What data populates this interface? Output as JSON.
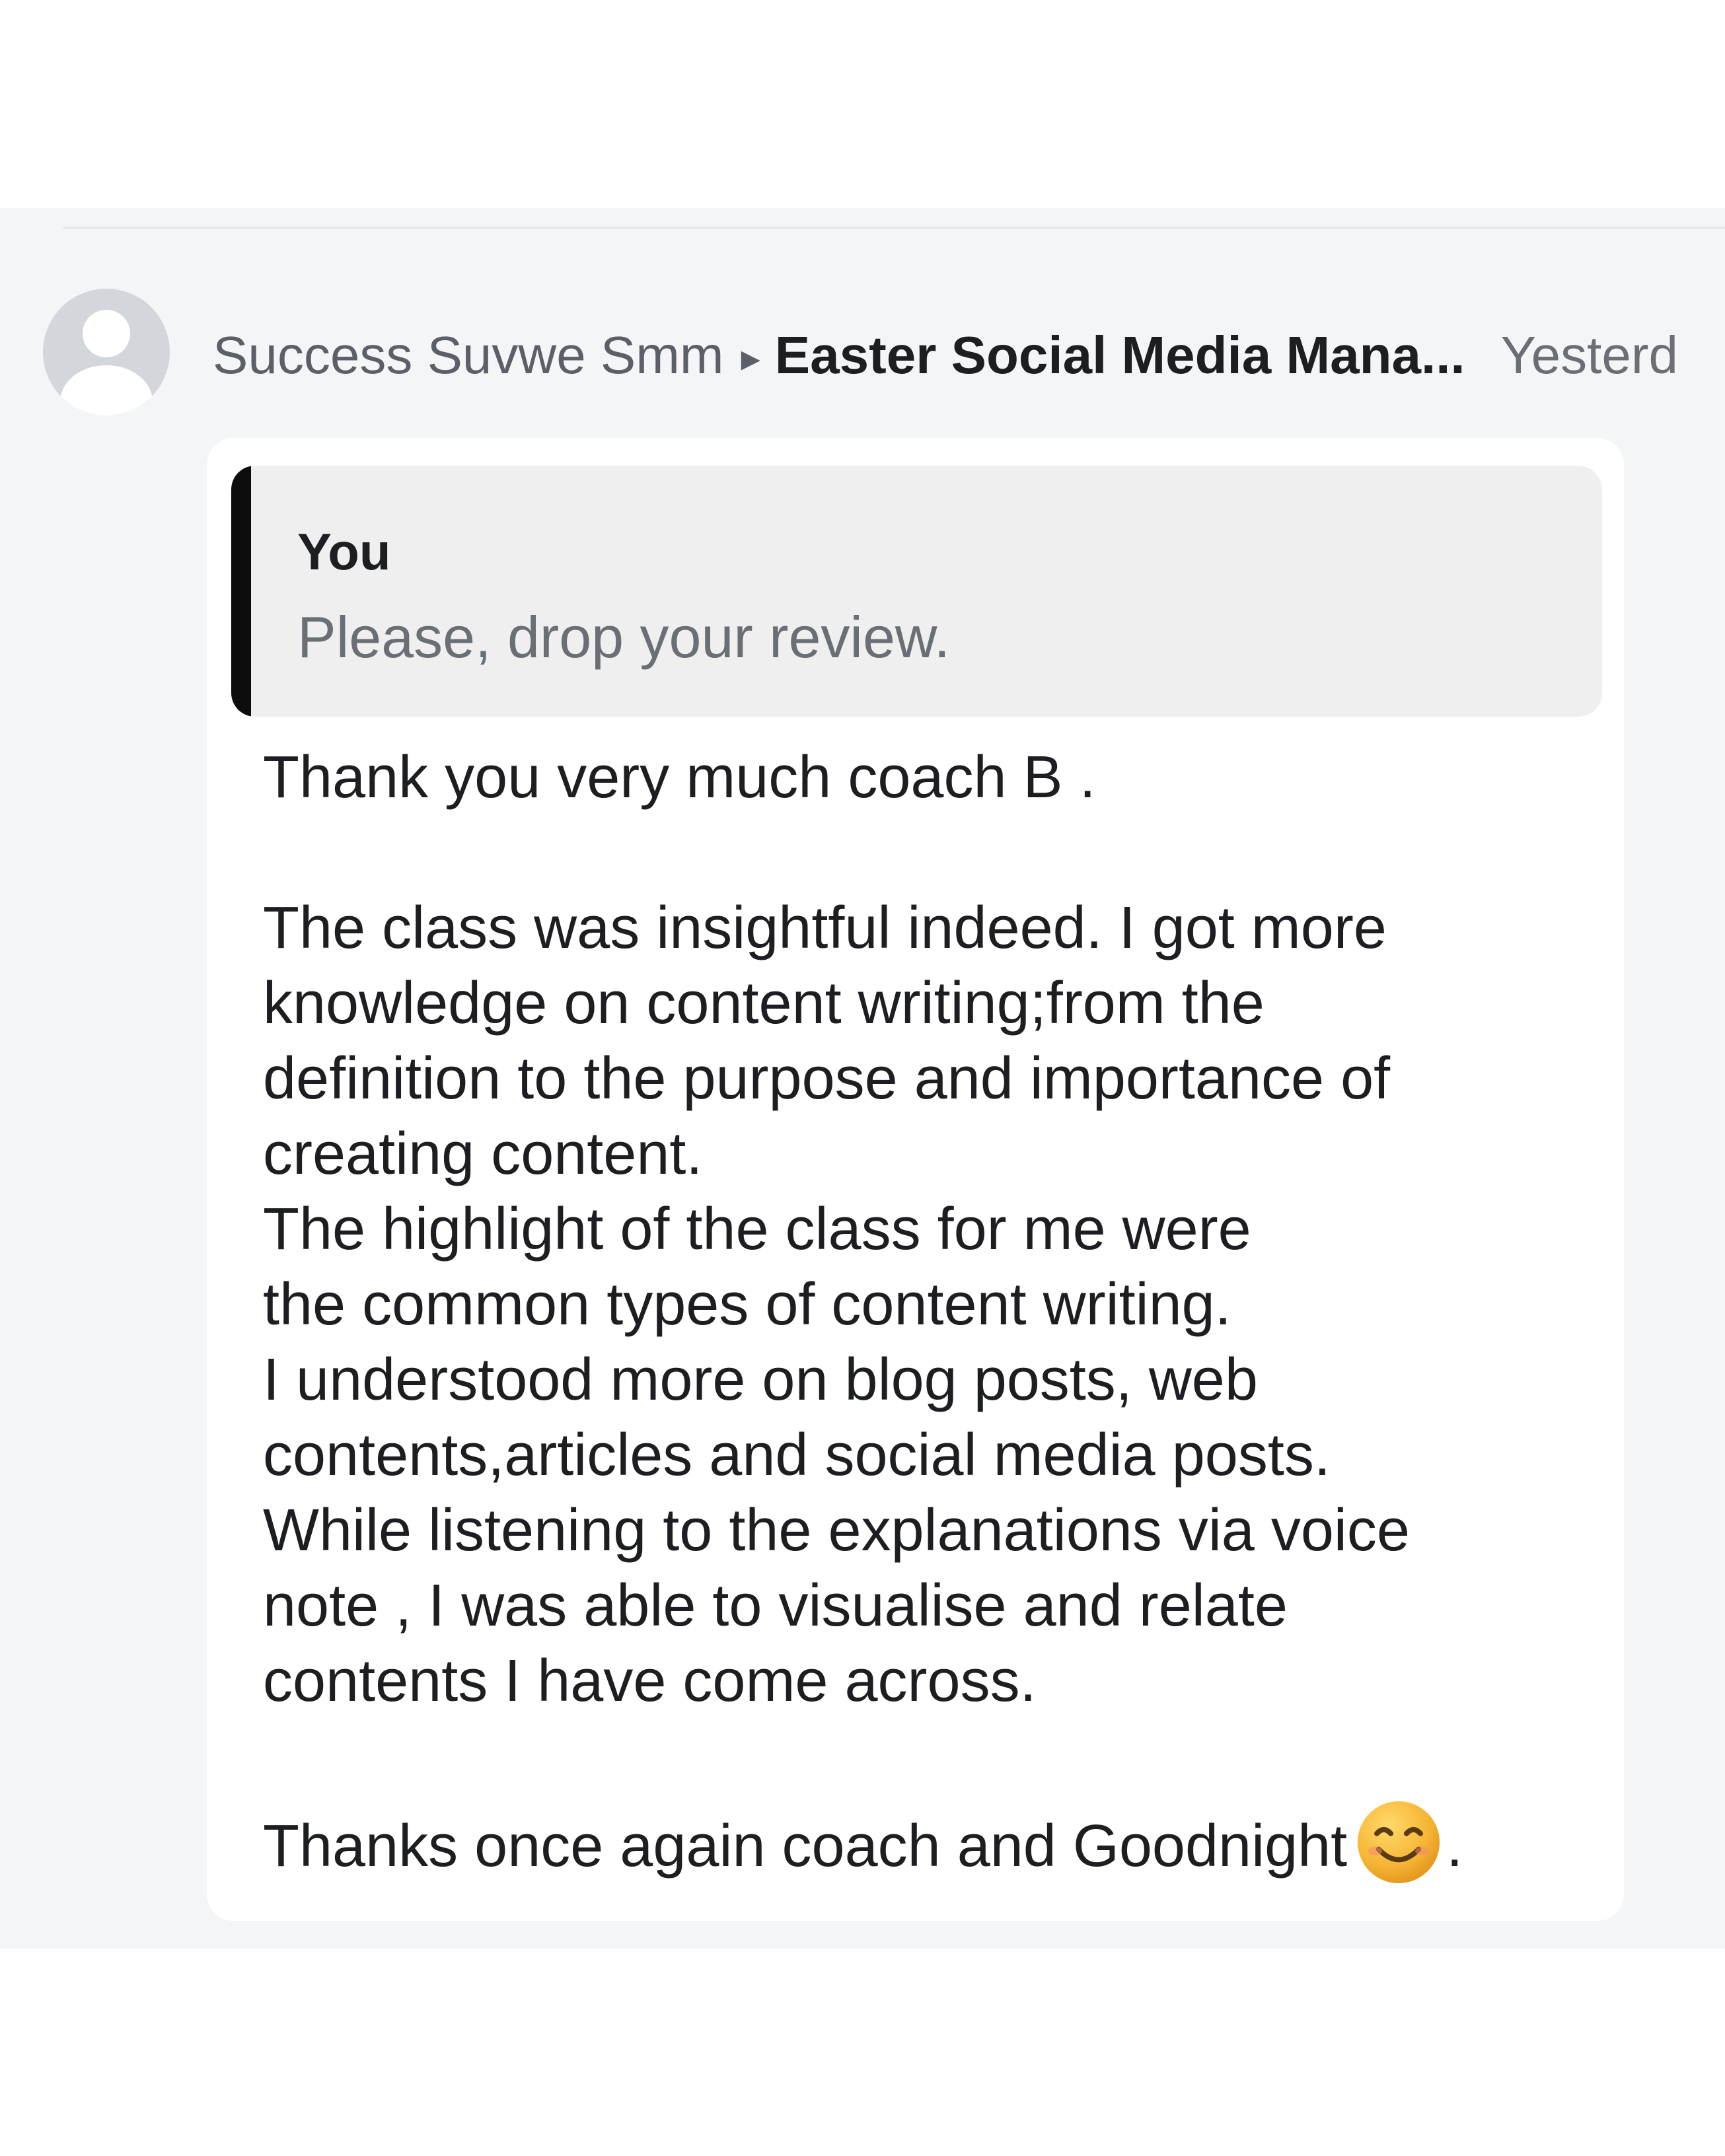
{
  "post_header": {
    "sender_name": "Success Suvwe Smm",
    "group_name": "Easter Social Media Mana...",
    "timestamp": "Yesterd"
  },
  "quoted_reply": {
    "author": "You",
    "text": "Please, drop your review."
  },
  "message": {
    "line_1": "Thank you very much coach B .",
    "line_2": "The class was insightful indeed. I got more",
    "line_3": "knowledge on content writing;from the",
    "line_4": "definition to the purpose and importance of",
    "line_5": "creating content.",
    "line_6": "The highlight of the class for me were",
    "line_7": "the common types of content writing.",
    "line_8": "I  understood more on blog posts, web",
    "line_9": "contents,articles and social media posts.",
    "line_10": "While listening to the explanations via voice",
    "line_11": "note , I was able to visualise and relate",
    "line_12": "contents I have come across.",
    "closing": "Thanks once again coach and Goodnight",
    "closing_punctuation": "."
  },
  "icons": {
    "avatar": "default-user-avatar",
    "separator": "triangle-right-icon",
    "emoji": "smiling-face-emoji"
  },
  "colors": {
    "panel_background": "#f4f5f7",
    "bubble_background": "#ffffff",
    "quote_background": "#efeff0",
    "quote_bar": "#0d0d0d",
    "primary_text": "#1c1e21",
    "secondary_text": "#5b6068",
    "emoji_fill": "#f6b535"
  }
}
